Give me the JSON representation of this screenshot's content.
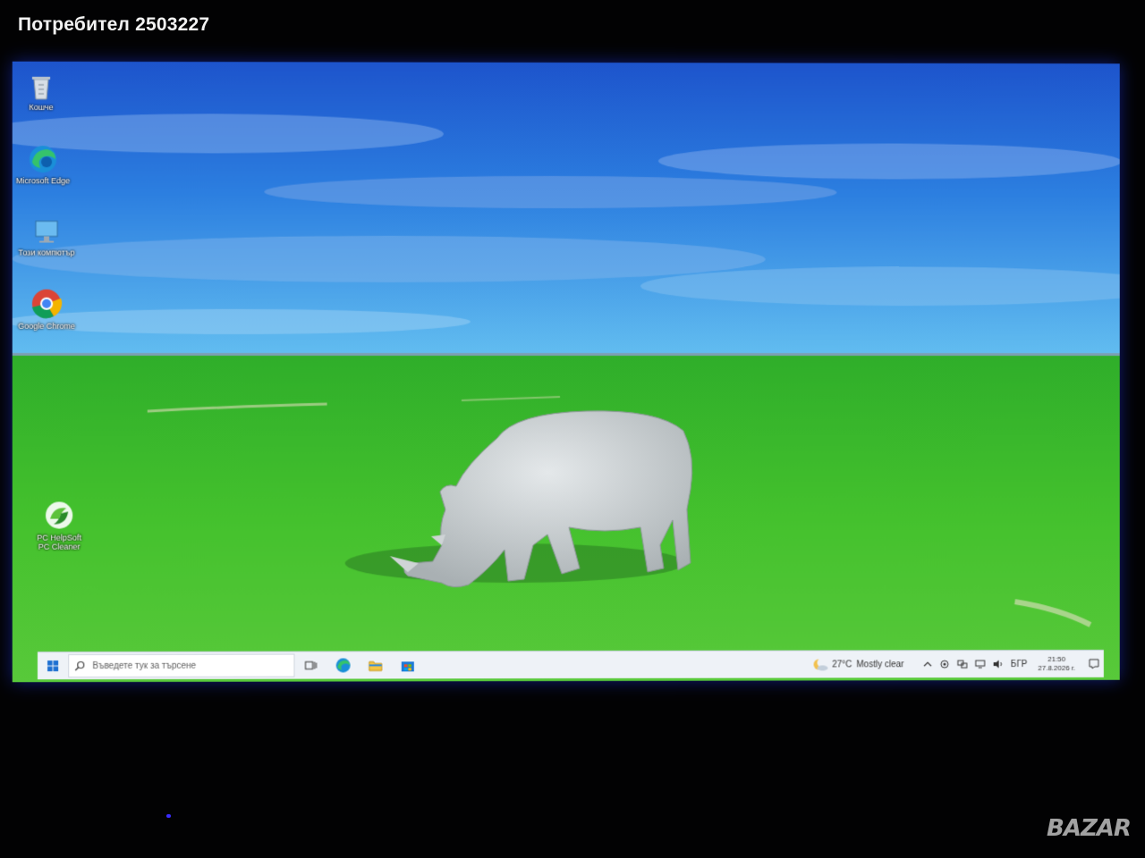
{
  "caption": "Потребител 2503227",
  "desktop": {
    "icons": [
      {
        "name": "recycle-bin",
        "label": "Кошче"
      },
      {
        "name": "microsoft-edge",
        "label": "Microsoft Edge"
      },
      {
        "name": "this-computer",
        "label": "Този компютър"
      },
      {
        "name": "google-chrome",
        "label": "Google Chrome"
      },
      {
        "name": "pc-helpsoft",
        "label": "PC HelpSoft PC Cleaner"
      }
    ]
  },
  "taskbar": {
    "search_placeholder": "Въведете тук за търсене",
    "weather_temp": "27°C",
    "weather_text": "Mostly clear",
    "language": "БГР",
    "time": "21:50",
    "date": "27.8.2026 г."
  },
  "watermark": "BAZAR",
  "colors": {
    "sky_top": "#1f5fd6",
    "sky_horizon": "#5fb4ee",
    "grass": "#3fbf2a",
    "taskbar": "#eef2f7"
  }
}
